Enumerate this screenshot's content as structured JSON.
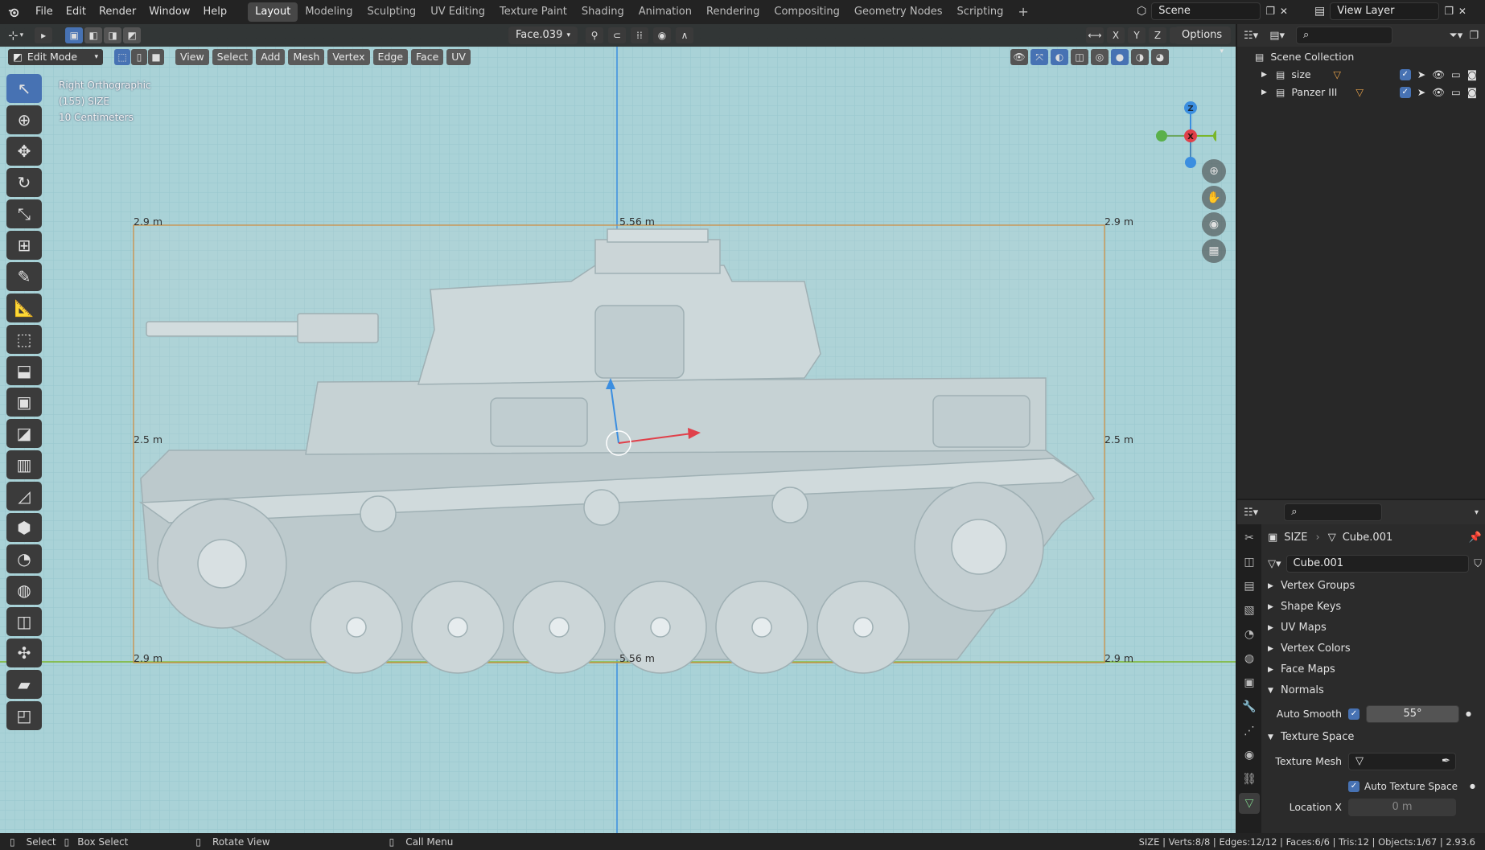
{
  "topbar": {
    "menus": [
      "File",
      "Edit",
      "Render",
      "Window",
      "Help"
    ],
    "workspaces": [
      "Layout",
      "Modeling",
      "Sculpting",
      "UV Editing",
      "Texture Paint",
      "Shading",
      "Animation",
      "Rendering",
      "Compositing",
      "Geometry Nodes",
      "Scripting"
    ],
    "active_workspace": "Layout",
    "add_tab": "+",
    "scene": "Scene",
    "view_layer": "View Layer"
  },
  "viewport": {
    "mode": "Edit Mode",
    "menus": [
      "View",
      "Select",
      "Add",
      "Mesh",
      "Vertex",
      "Edge",
      "Face",
      "UV"
    ],
    "active_face": "Face.039",
    "axes": [
      "X",
      "Y",
      "Z"
    ],
    "options": "Options",
    "overlay_lines": [
      "Right Orthographic",
      "(155) SIZE",
      "10 Centimeters"
    ],
    "dims": {
      "top_left": "2.9 m",
      "top_center": "5.56 m",
      "top_right": "2.9 m",
      "mid_left": "2.5 m",
      "mid_right": "2.5 m",
      "bot_left": "2.9 m",
      "bot_center": "5.56 m",
      "bot_right": "2.9 m"
    },
    "gizmo": {
      "x": "X",
      "y": "Y",
      "z": "Z"
    },
    "colors": {
      "bg": "#a9d2d7",
      "grid": "#8fbfc6",
      "bbox": "#d08a3a",
      "x_axis": "#e0404a",
      "y_axis": "#7ab62a",
      "z_axis": "#3b8ee0"
    }
  },
  "outliner": {
    "title": "Scene Collection",
    "items": [
      {
        "name": "size"
      },
      {
        "name": "Panzer III"
      }
    ]
  },
  "properties": {
    "breadcrumb_object": "SIZE",
    "breadcrumb_data": "Cube.001",
    "data_name": "Cube.001",
    "panels": [
      "Vertex Groups",
      "Shape Keys",
      "UV Maps",
      "Vertex Colors",
      "Face Maps",
      "Normals",
      "Texture Space"
    ],
    "auto_smooth_label": "Auto Smooth",
    "auto_smooth_value": "55°",
    "texture_mesh_label": "Texture Mesh",
    "auto_texture_space_label": "Auto Texture Space",
    "location_x_label": "Location X",
    "location_x_value": "0 m"
  },
  "statusbar": {
    "select": "Select",
    "box_select": "Box Select",
    "rotate_view": "Rotate View",
    "call_menu": "Call Menu",
    "stats": "SIZE | Verts:8/8 | Edges:12/12 | Faces:6/6 | Tris:12 | Objects:1/67 | 2.93.6"
  }
}
